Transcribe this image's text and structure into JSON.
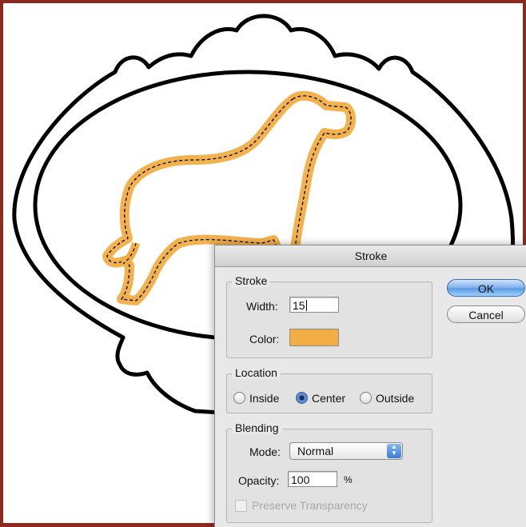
{
  "dialog": {
    "title": "Stroke",
    "ok_label": "OK",
    "cancel_label": "Cancel",
    "stroke_group": {
      "legend": "Stroke",
      "width_label": "Width:",
      "width_value": "15",
      "color_label": "Color:",
      "color_value": "#f2ae45"
    },
    "location_group": {
      "legend": "Location",
      "options": [
        "Inside",
        "Center",
        "Outside"
      ],
      "selected": "Center"
    },
    "blending_group": {
      "legend": "Blending",
      "mode_label": "Mode:",
      "mode_value": "Normal",
      "opacity_label": "Opacity:",
      "opacity_value": "100",
      "opacity_unit": "%",
      "preserve_label": "Preserve Transparency",
      "preserve_checked": false,
      "preserve_enabled": false
    }
  },
  "colors": {
    "stroke_orange": "#f2ae45",
    "frame_black": "#000000",
    "dialog_bg": "#e8e8e8",
    "button_blue": "#5d9ae6"
  },
  "icons": {
    "popup_arrows": "updown-arrows-icon",
    "selection": "marching-ants-dog-selection"
  }
}
